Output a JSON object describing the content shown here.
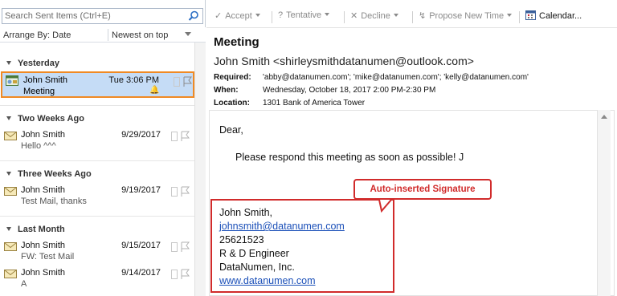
{
  "search": {
    "placeholder": "Search Sent Items (Ctrl+E)"
  },
  "arrange": {
    "by_label": "Arrange By: Date",
    "order_label": "Newest on top"
  },
  "groups": [
    {
      "label": "Yesterday"
    },
    {
      "label": "Two Weeks Ago"
    },
    {
      "label": "Three Weeks Ago"
    },
    {
      "label": "Last Month"
    }
  ],
  "messages": [
    {
      "from": "John Smith",
      "subject": "Meeting",
      "date": "Tue 3:06 PM",
      "icon": "meeting-icon",
      "selected": true
    },
    {
      "from": "John Smith",
      "subject": "Hello ^^^",
      "date": "9/29/2017",
      "icon": "envelope-icon"
    },
    {
      "from": "John Smith",
      "subject": "Test Mail, thanks",
      "date": "9/19/2017",
      "icon": "envelope-icon"
    },
    {
      "from": "John Smith",
      "subject": "FW: Test Mail",
      "date": "9/15/2017",
      "icon": "envelope-icon"
    },
    {
      "from": "John Smith",
      "subject": "A",
      "date": "9/14/2017",
      "icon": "envelope-icon"
    }
  ],
  "toolbar": {
    "accept": "Accept",
    "tentative": "Tentative",
    "decline": "Decline",
    "propose": "Propose New Time",
    "calendar": "Calendar..."
  },
  "reading": {
    "title": "Meeting",
    "from": "John Smith <shirleysmithdatanumen@outlook.com>",
    "required_label": "Required:",
    "required": "'abby@datanumen.com'; 'mike@datanumen.com'; 'kelly@datanumen.com'",
    "when_label": "When:",
    "when": "Wednesday, October 18, 2017 2:00 PM-2:30 PM",
    "location_label": "Location:",
    "location": "1301 Bank of America Tower"
  },
  "body": {
    "greeting": "Dear,",
    "line1": "Please respond this meeting as soon as possible! J",
    "sig_name": "John Smith,",
    "sig_email": "johnsmith@datanumen.com",
    "sig_phone": "25621523",
    "sig_title": "R & D Engineer",
    "sig_company": "DataNumen, Inc.",
    "sig_web": "www.datanumen.com"
  },
  "annotation": {
    "callout": "Auto-inserted Signature"
  },
  "colors": {
    "selection": "#c5dcf6",
    "selection_border": "#f08a24",
    "annotation": "#d12b2b",
    "link": "#1a4fb8"
  }
}
